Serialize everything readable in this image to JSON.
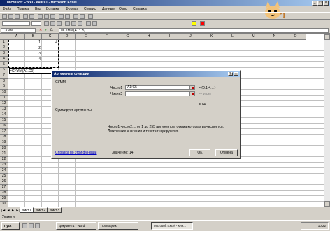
{
  "window": {
    "title": "Microsoft Excel - Книга1 - Microsoft Excel"
  },
  "menu": [
    "Файл",
    "Правка",
    "Вид",
    "Вставка",
    "Формат",
    "Сервис",
    "Данные",
    "Окно",
    "Справка"
  ],
  "formula_bar": {
    "name_box": "СУММ",
    "formula": "=СУММ(A1:C5)"
  },
  "columns": [
    "A",
    "B",
    "C",
    "D",
    "E",
    "F",
    "G",
    "H",
    "I",
    "J",
    "K",
    "L",
    "M",
    "N",
    "O"
  ],
  "rows": [
    "1",
    "2",
    "3",
    "4",
    "5",
    "6",
    "7",
    "8",
    "9",
    "10",
    "11",
    "12",
    "13",
    "14",
    "15",
    "16",
    "17",
    "18",
    "19",
    "20",
    "21",
    "22",
    "23",
    "24",
    "25",
    "26",
    "27",
    "28",
    "29",
    "30"
  ],
  "cells": [
    {
      "ref": "B1",
      "value": "1"
    },
    {
      "ref": "C1",
      "value": "4"
    },
    {
      "ref": "B2",
      "value": "2"
    },
    {
      "ref": "B3",
      "value": "3"
    },
    {
      "ref": "B4",
      "value": "4"
    },
    {
      "ref": "A6",
      "value": "=СУММ(A1:C5)"
    }
  ],
  "dialog": {
    "title": "Аргументы функции",
    "function_name": "СУММ",
    "arg1_label": "Число1",
    "arg1_value": "A1:C5",
    "arg1_result": "= {0;1;4;...}",
    "arg2_label": "Число2",
    "arg2_result": "= число",
    "total_result": "= 14",
    "description": "Суммирует аргументы.",
    "help_text": "Число1;число2;... от 1 до 255 аргументов, сумма которых вычисляется. Логические значения и текст игнорируются.",
    "help_link": "Справка по этой функции",
    "value_label": "Значение: 14",
    "ok_label": "OK",
    "cancel_label": "Отмена",
    "help_btn": "?",
    "close_btn": "×"
  },
  "sheet_tabs": [
    "Лист1",
    "Лист2",
    "Лист3"
  ],
  "status": {
    "text": "Укажите"
  },
  "taskbar": {
    "start": "Пуск",
    "tasks": [
      "Документ1 - Word",
      "Проводник",
      "Microsoft Excel - Кни..."
    ],
    "clock": "10:22"
  }
}
